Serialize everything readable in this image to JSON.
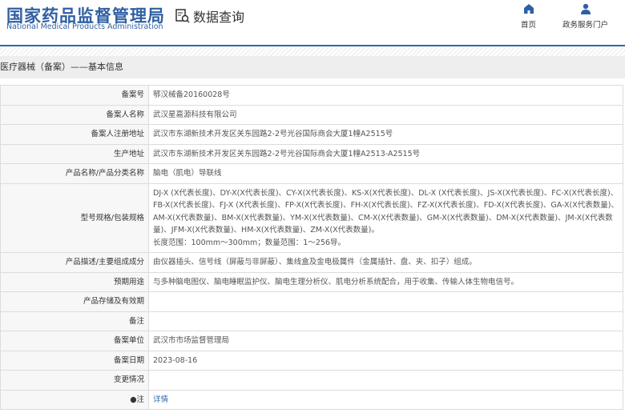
{
  "header": {
    "logo_cn": "国家药品监督管理局",
    "logo_en": "National Medical Products Administration",
    "title": "数据查询",
    "nav": [
      {
        "label": "首页"
      },
      {
        "label": "政务服务门户"
      }
    ]
  },
  "section_title": "医疗器械（备案）——基本信息",
  "rows": [
    {
      "label": "备案号",
      "value": "鄂汉械备20160028号"
    },
    {
      "label": "备案人名称",
      "value": "武汉星嘉源科技有限公司"
    },
    {
      "label": "备案人注册地址",
      "value": "武汉市东湖新技术开发区关东园路2-2号光谷国际商会大厦1幢A2515号"
    },
    {
      "label": "生产地址",
      "value": "武汉市东湖新技术开发区关东园路2-2号光谷国际商会大厦1幢A2513-A2515号"
    },
    {
      "label": "产品名称/产品分类名称",
      "value": "脑电（肌电）导联线"
    },
    {
      "label": "型号规格/包装规格",
      "value": "DJ-X (X代表长度)、DY-X(X代表长度)、CY-X(X代表长度)、KS-X(X代表长度)、DL-X (X代表长度)、JS-X(X代表长度)、FC-X(X代表长度)、FB-X(X代表长度)、FJ-X (X代表长度)、FP-X(X代表长度)、FH-X(X代表长度)、FZ-X(X代表长度)、FD-X(X代表长度)、GA-X(X代表数量)、AM-X(X代表数量)、BM-X(X代表数量)、YM-X(X代表数量)、CM-X(X代表数量)、GM-X(X代表数量)、DM-X(X代表数量)、JM-X(X代表数量)、JFM-X(X代表数量)、HM-X(X代表数量)、ZM-X(X代表数量)。",
      "value2": "长度范围：100mm～300mm；数量范围：1～256导。"
    },
    {
      "label": "产品描述/主要组成成分",
      "value": "由仪器插头、信号线（屏蔽与非屏蔽）、集线盒及金电极属件（金属插针、盘、夹、扣子）组成。"
    },
    {
      "label": "预期用途",
      "value": "与多种脑电图仪、脑电睡眠监护仪、脑电生理分析仪、肌电分析系统配合，用于收集、传输人体生物电信号。"
    },
    {
      "label": "产品存储及有效期",
      "value": ""
    },
    {
      "label": "备注",
      "value": ""
    },
    {
      "label": "备案单位",
      "value": "武汉市市场监督管理局"
    },
    {
      "label": "备案日期",
      "value": "2023-08-16"
    },
    {
      "label": "变更情况",
      "value": ""
    }
  ],
  "note": {
    "label": "注",
    "link": "详情"
  }
}
